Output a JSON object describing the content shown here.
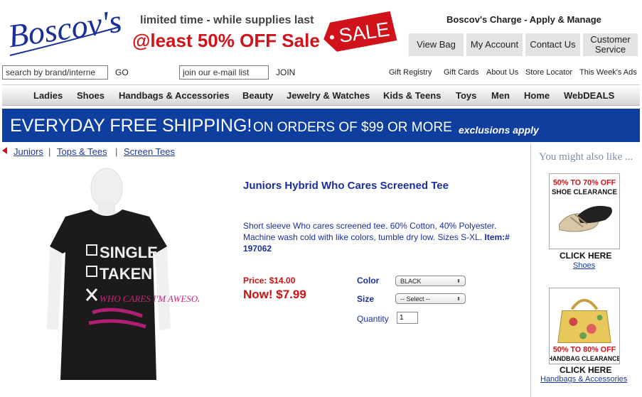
{
  "header": {
    "logo_text": "Boscov's",
    "promo_line1": "limited time - while supplies last",
    "promo_line2": "@least 50% OFF Sale",
    "sale_tag": "SALE",
    "charge_link": "Boscov's Charge - Apply & Manage",
    "buttons": [
      "View Bag",
      "My Account",
      "Contact Us",
      "Customer Service"
    ]
  },
  "search": {
    "value": "search by brand/interne",
    "go_label": "GO",
    "email_value": "join our e-mail list",
    "join_label": "JOIN"
  },
  "utility_links": [
    "Gift Registry",
    "Gift Cards",
    "About Us",
    "Store Locator",
    "This Week's Ads"
  ],
  "nav": [
    "Ladies",
    "Shoes",
    "Handbags & Accessories",
    "Beauty",
    "Jewelry & Watches",
    "Kids & Teens",
    "Toys",
    "Men",
    "Home",
    "WebDEALS"
  ],
  "shipping": {
    "main": "EVERYDAY FREE SHIPPING!",
    "sub": "ON ORDERS OF $99 OR MORE",
    "exclusions": "exclusions apply"
  },
  "breadcrumb": [
    "Juniors",
    "Tops & Tees",
    "Screen Tees"
  ],
  "product": {
    "title": "Juniors Hybrid Who Cares Screened Tee",
    "description": "Short sleeve Who cares screened tee. 60% Cotton, 40% Polyester. Machine wash cold with like colors, tumble dry low. Sizes S-XL.",
    "item_number": "Item:# 197062",
    "price": "Price: $14.00",
    "now_price": "Now! $7.99",
    "shirt_text": [
      "SINGLE",
      "TAKEN",
      "WHO CARES I'M AWESOME"
    ],
    "options": {
      "color_label": "Color",
      "color_value": "BLACK",
      "size_label": "Size",
      "size_value": "-- Select --",
      "quantity_label": "Quantity",
      "quantity_value": "1"
    }
  },
  "sidebar": {
    "title": "You might also like ...",
    "ads": [
      {
        "headline": "50% TO 70% OFF",
        "sub": "SHOE CLEARANCE",
        "click": "CLICK HERE",
        "link": "Shoes"
      },
      {
        "headline": "50% TO 80% OFF",
        "sub": "HANDBAG CLEARANCE",
        "click": "CLICK HERE",
        "link": "Handbags & Accessories"
      }
    ]
  },
  "colors": {
    "brand_blue": "#1a2f99",
    "banner_blue": "#0f3f9e",
    "sale_red": "#d0121b"
  }
}
